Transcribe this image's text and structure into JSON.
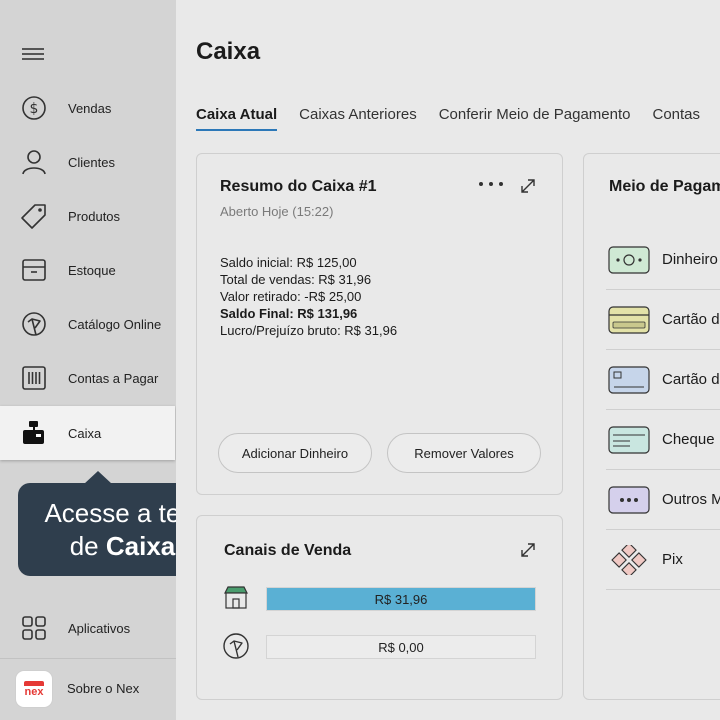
{
  "sidebar": {
    "items": [
      {
        "label": "Vendas",
        "icon": "dollar-circle-icon"
      },
      {
        "label": "Clientes",
        "icon": "user-icon"
      },
      {
        "label": "Produtos",
        "icon": "tag-icon"
      },
      {
        "label": "Estoque",
        "icon": "box-icon"
      },
      {
        "label": "Catálogo Online",
        "icon": "catalog-icon"
      },
      {
        "label": "Contas a Pagar",
        "icon": "barcode-icon"
      },
      {
        "label": "Caixa",
        "icon": "cash-register-icon"
      },
      {
        "label": "Aplicativos",
        "icon": "grid-icon"
      },
      {
        "label": "Sobre o Nex",
        "icon": "nex-logo"
      }
    ],
    "logo_text": "nex"
  },
  "tooltip": {
    "line1": "Acesse a tela",
    "line2_prefix": "de ",
    "line2_bold": "Caixa"
  },
  "main": {
    "title": "Caixa",
    "tabs": [
      "Caixa Atual",
      "Caixas Anteriores",
      "Conferir Meio de Pagamento",
      "Contas"
    ],
    "resumo": {
      "title": "Resumo do Caixa #1",
      "subtitle": "Aberto Hoje (15:22)",
      "lines": [
        "Saldo inicial: R$ 125,00",
        "Total de vendas: R$ 31,96",
        "Valor retirado: -R$ 25,00",
        "Saldo Final: R$ 131,96",
        "Lucro/Prejuízo bruto: R$ 31,96"
      ],
      "add_button": "Adicionar Dinheiro",
      "remove_button": "Remover Valores"
    },
    "canais": {
      "title": "Canais de Venda",
      "channels": [
        {
          "icon": "store-icon",
          "value": "R$ 31,96",
          "fill": 1.0,
          "color": "#5ab0d4"
        },
        {
          "icon": "catalog-icon",
          "value": "R$ 0,00",
          "fill": 0.0,
          "color": "#5ab0d4"
        }
      ]
    },
    "meio": {
      "title": "Meio de Pagamento",
      "methods": [
        {
          "label": "Dinheiro",
          "icon": "cash-icon"
        },
        {
          "label": "Cartão de Crédito",
          "icon": "credit-card-icon"
        },
        {
          "label": "Cartão de Débito",
          "icon": "debit-card-icon"
        },
        {
          "label": "Cheque",
          "icon": "check-icon"
        },
        {
          "label": "Outros Meios",
          "icon": "more-icon"
        },
        {
          "label": "Pix",
          "icon": "pix-icon"
        }
      ]
    }
  }
}
